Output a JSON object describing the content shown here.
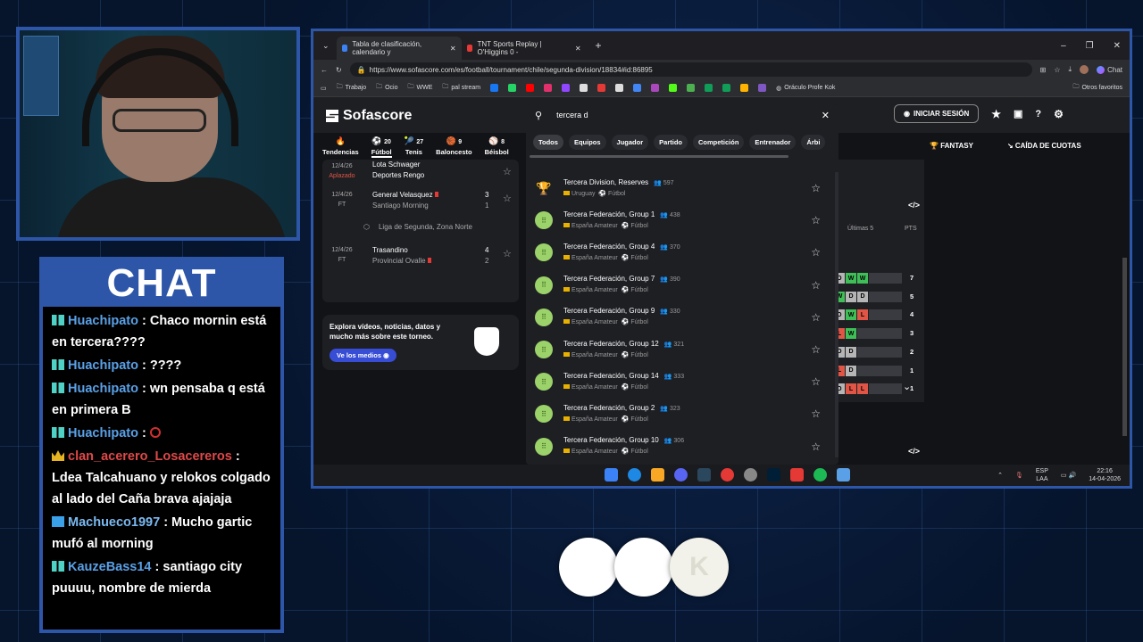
{
  "chat": {
    "title": "CHAT",
    "messages": [
      {
        "user": "Huachipato",
        "badge": "bits",
        "user_color": "#5aa0e6",
        "text": ": Chaco mornin está en tercera????"
      },
      {
        "user": "Huachipato",
        "badge": "bits",
        "user_color": "#5aa0e6",
        "text": ": ????"
      },
      {
        "user": "Huachipato",
        "badge": "bits",
        "user_color": "#5aa0e6",
        "text": ": wn pensaba q está en primera B"
      },
      {
        "user": "Huachipato",
        "badge": "bits",
        "user_color": "#5aa0e6",
        "text": ":"
      },
      {
        "user": "clan_acerero_Losacereros",
        "badge": "crown",
        "user_color": "#e04848",
        "text": ": Ldea Talcahuano y relokos colgado al lado del Caña brava ajajaja"
      },
      {
        "user": "Machueco1997",
        "badge": "arrow",
        "user_color": "#7ab9f0",
        "text": ": Mucho gartic mufó al morning"
      },
      {
        "user": "KauzeBass14",
        "badge": "bits",
        "user_color": "#5aa0e6",
        "text": ": santiago city puuuu, nombre de mierda"
      }
    ]
  },
  "browser": {
    "tabs": [
      {
        "label": "Tabla de clasificación, calendario y",
        "active": true
      },
      {
        "label": "TNT Sports Replay | O'Higgins 0 -",
        "active": false
      }
    ],
    "url": "https://www.sofascore.com/es/football/tournament/chile/segunda-division/18834#id:86895",
    "bookmarks": [
      "Trabajo",
      "Ocio",
      "WWE",
      "pal stream",
      "Oráculo Profe Kok"
    ],
    "other_bookmarks": "Otros favoritos",
    "chat_button": "Chat"
  },
  "sofascore": {
    "logo": "Sofascore",
    "search_value": "tercera d",
    "login": "INICIAR SESIÓN",
    "fantasy": "FANTASY",
    "odds": "CAÍDA DE CUOTAS",
    "sports": [
      {
        "label": "Tendencias",
        "count": ""
      },
      {
        "label": "Fútbol",
        "count": "20"
      },
      {
        "label": "Tenis",
        "count": "27"
      },
      {
        "label": "Baloncesto",
        "count": "9"
      },
      {
        "label": "Béisbol",
        "count": "8"
      }
    ],
    "filters": [
      "Todos",
      "Equipos",
      "Jugador",
      "Partido",
      "Competición",
      "Entrenador",
      "Árbi"
    ],
    "matches": [
      {
        "date": "12/4/26",
        "status": "Aplazado",
        "home": "Lota Schwager",
        "away": "Deportes Rengo",
        "hs": "",
        "as": ""
      },
      {
        "date": "12/4/26",
        "status": "FT",
        "home": "General Velasquez",
        "away": "Santiago Morning",
        "hs": "3",
        "as": "1"
      },
      {
        "date": "12/4/26",
        "status": "FT",
        "home": "Trasandino",
        "away": "Provincial Ovalle",
        "hs": "4",
        "as": "2"
      }
    ],
    "league_label": "Liga de Segunda, Zona Norte",
    "promo_text": "Explora vídeos, noticias, datos y mucho más sobre este torneo.",
    "promo_button": "Ve los medios",
    "table_headers": {
      "last5": "Últimas 5",
      "pts": "PTS"
    },
    "form_rows": [
      {
        "form": [
          "D",
          "W",
          "W"
        ],
        "pts": "7"
      },
      {
        "form": [
          "W",
          "D",
          "D"
        ],
        "pts": "5"
      },
      {
        "form": [
          "D",
          "W",
          "L"
        ],
        "pts": "4"
      },
      {
        "form": [
          "L",
          "W"
        ],
        "pts": "3"
      },
      {
        "form": [
          "D",
          "D"
        ],
        "pts": "2"
      },
      {
        "form": [
          "L",
          "D"
        ],
        "pts": "1"
      },
      {
        "form": [
          "D",
          "L",
          "L"
        ],
        "pts": "1"
      }
    ],
    "results": [
      {
        "name": "Tercera Division, Reserves",
        "count": "597",
        "country": "Uruguay",
        "sport": "Fútbol",
        "icon": "trophy"
      },
      {
        "name": "Tercera Federación, Group 1",
        "count": "438",
        "country": "España Amateur",
        "sport": "Fútbol",
        "icon": "league"
      },
      {
        "name": "Tercera Federación, Group 4",
        "count": "370",
        "country": "España Amateur",
        "sport": "Fútbol",
        "icon": "league"
      },
      {
        "name": "Tercera Federación, Group 7",
        "count": "390",
        "country": "España Amateur",
        "sport": "Fútbol",
        "icon": "league"
      },
      {
        "name": "Tercera Federación, Group 9",
        "count": "330",
        "country": "España Amateur",
        "sport": "Fútbol",
        "icon": "league"
      },
      {
        "name": "Tercera Federación, Group 12",
        "count": "321",
        "country": "España Amateur",
        "sport": "Fútbol",
        "icon": "league"
      },
      {
        "name": "Tercera Federación, Group 14",
        "count": "333",
        "country": "España Amateur",
        "sport": "Fútbol",
        "icon": "league"
      },
      {
        "name": "Tercera Federación, Group 2",
        "count": "323",
        "country": "España Amateur",
        "sport": "Fútbol",
        "icon": "league"
      },
      {
        "name": "Tercera Federación, Group 10",
        "count": "306",
        "country": "España Amateur",
        "sport": "Fútbol",
        "icon": "league"
      }
    ]
  },
  "taskbar": {
    "lang": "ESP",
    "layout": "LAA",
    "time": "22:16",
    "date": "14-04-2026"
  }
}
